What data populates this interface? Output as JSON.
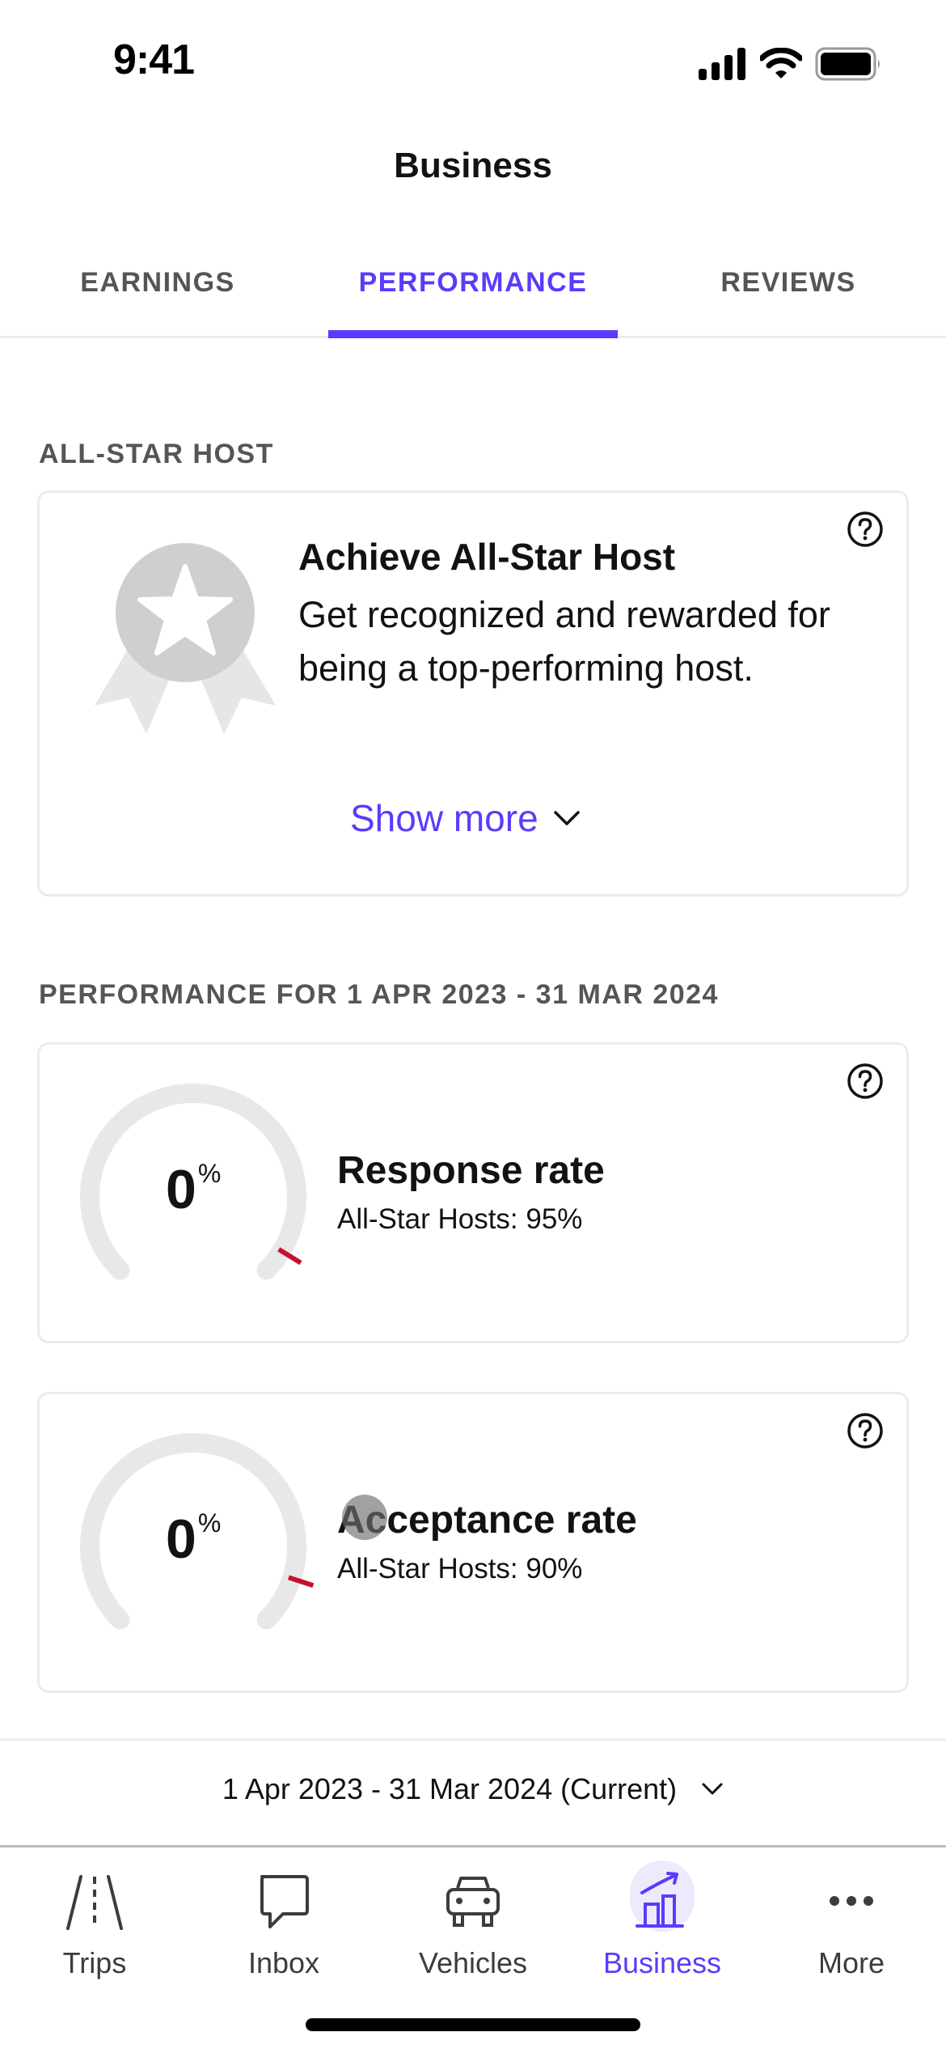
{
  "status_bar": {
    "time": "9:41",
    "icons": [
      "signal-icon",
      "wifi-icon",
      "battery-icon"
    ]
  },
  "header": {
    "title": "Business"
  },
  "tabs": [
    {
      "label": "EARNINGS",
      "active": false
    },
    {
      "label": "PERFORMANCE",
      "active": true
    },
    {
      "label": "REVIEWS",
      "active": false
    }
  ],
  "all_star": {
    "section_label": "ALL-STAR HOST",
    "title": "Achieve All-Star Host",
    "description": "Get recognized and rewarded for being a top-performing host.",
    "show_more_label": "Show more",
    "icons": [
      "badge-icon",
      "help-icon",
      "chevron-down-icon"
    ]
  },
  "performance": {
    "section_label": "PERFORMANCE FOR 1 APR 2023 - 31 MAR 2024",
    "metrics": [
      {
        "title": "Response rate",
        "value": "0",
        "unit": "%",
        "value_fraction": 0.0,
        "target_label": "All-Star Hosts: 95%",
        "target_fraction": 0.95
      },
      {
        "title": "Acceptance rate",
        "value": "0",
        "unit": "%",
        "value_fraction": 0.0,
        "target_label": "All-Star Hosts: 90%",
        "target_fraction": 0.9
      }
    ]
  },
  "date_range": {
    "label": "1 Apr 2023 - 31 Mar 2024 (Current)"
  },
  "bottom_nav": [
    {
      "label": "Trips",
      "icon": "road-icon",
      "active": false
    },
    {
      "label": "Inbox",
      "icon": "chat-bubble-icon",
      "active": false
    },
    {
      "label": "Vehicles",
      "icon": "car-icon",
      "active": false
    },
    {
      "label": "Business",
      "icon": "chart-growth-icon",
      "active": true
    },
    {
      "label": "More",
      "icon": "more-dots-icon",
      "active": false
    }
  ],
  "colors": {
    "accent": "#593cfb",
    "target_tick": "#c8102e",
    "gauge_track": "#e8e8ea",
    "muted_text": "#555557"
  }
}
